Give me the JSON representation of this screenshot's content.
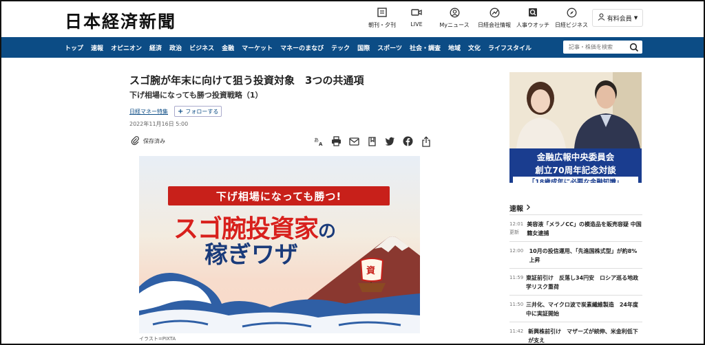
{
  "header": {
    "logo": "日本経済新聞",
    "icons": [
      {
        "name": "newspaper-icon",
        "label": "朝刊・夕刊"
      },
      {
        "name": "video-icon",
        "label": "LIVE"
      },
      {
        "name": "my-news-icon",
        "label": "Myニュース"
      },
      {
        "name": "company-info-icon",
        "label": "日経会社情報"
      },
      {
        "name": "jinji-icon",
        "label": "人事ウオッチ"
      },
      {
        "name": "compass-icon",
        "label": "日経ビジネス"
      }
    ],
    "member_label": "有料会員"
  },
  "nav": {
    "items": [
      "トップ",
      "速報",
      "オピニオン",
      "経済",
      "政治",
      "ビジネス",
      "金融",
      "マーケット",
      "マネーのまなび",
      "テック",
      "国際",
      "スポーツ",
      "社会・調査",
      "地域",
      "文化",
      "ライフスタイル"
    ],
    "search_placeholder": "記事・株価を検索"
  },
  "article": {
    "title": "スゴ腕が年末に向けて狙う投資対象　3つの共通項",
    "subtitle": "下げ相場になっても勝つ投資戦略（1）",
    "series": "日経マネー特集",
    "follow_label": "フォローする",
    "date": "2022年11月16日 5:00",
    "saved_label": "保存済み",
    "hero": {
      "ribbon": "下げ相場になっても勝つ!",
      "line1": "スゴ腕投資家",
      "line1_suffix": "の",
      "line2": "稼ぎワザ",
      "boat_mark": "資"
    },
    "caption": "イラスト=PIXTA"
  },
  "ad": {
    "line1": "金融広報中央委員会",
    "line2": "創立70周年記念対談",
    "line3": "「18歳成年に必要な金融知識」"
  },
  "sokuho": {
    "heading": "速報",
    "items": [
      {
        "time": "12:01",
        "status": "更新",
        "text": "美容液「メラノCC」の模造品を販売容疑 中国籍女逮捕"
      },
      {
        "time": "12:00",
        "status": "",
        "text": "10月の投信運用、「先進国株式型」が約8%上昇"
      },
      {
        "time": "11:59",
        "status": "",
        "text": "東証前引け　反落し34円安　ロシア巡る地政学リスク重荷"
      },
      {
        "time": "11:50",
        "status": "",
        "text": "三井化、マイクロ波で炭素繊維製造　24年度中に実証開始"
      },
      {
        "time": "11:42",
        "status": "",
        "text": "新興株前引け　マザーズが続伸、米金利低下が支え"
      }
    ]
  }
}
